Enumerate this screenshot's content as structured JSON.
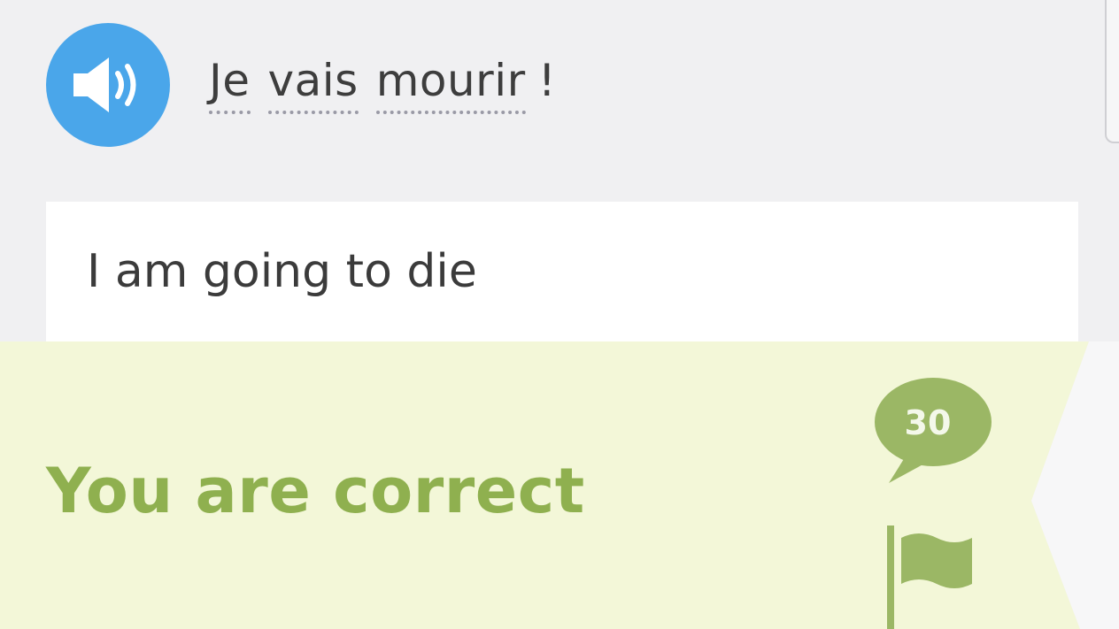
{
  "prompt": {
    "audio_icon": "speaker-icon",
    "words": [
      "Je",
      "vais",
      "mourir"
    ],
    "punctuation": "!"
  },
  "answer": {
    "text": "I am going to die"
  },
  "result": {
    "message": "You are correct",
    "discussion_count": "30",
    "discussion_icon": "speech-bubble-icon",
    "report_icon": "flag-icon"
  },
  "colors": {
    "speaker_button": "#4aa6ea",
    "banner_background": "#f3f7d8",
    "accent_green": "#8fb04f",
    "page_background": "#f0f0f2"
  }
}
